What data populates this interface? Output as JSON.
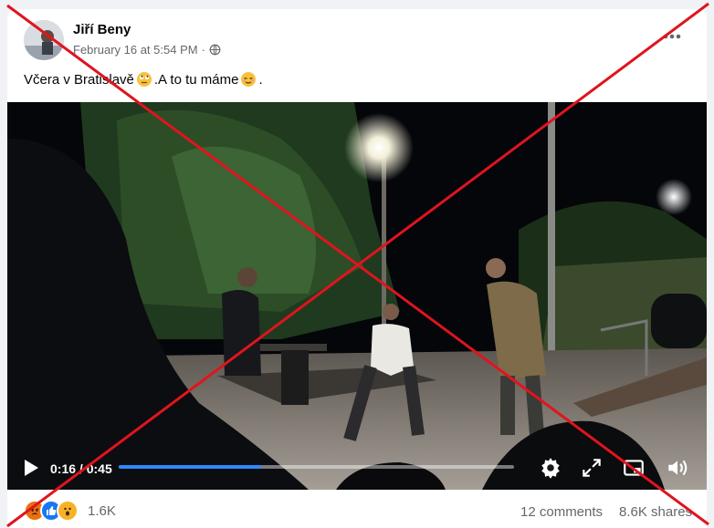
{
  "post": {
    "author": "Jiří Beny",
    "date": "February 16 at 5:54 PM",
    "separator": "·",
    "text_part1": "Včera v Bratislavě",
    "text_part2": ".A to tu máme",
    "text_part3": "."
  },
  "video": {
    "time_elapsed": "0:16",
    "time_separator": " / ",
    "time_total": "0:45",
    "progress_fraction": 0.36
  },
  "footer": {
    "reaction_count": "1.6K",
    "comments": "12 comments",
    "shares": "8.6K shares"
  },
  "colors": {
    "progress": "#2d88ff",
    "cross": "#e0141e",
    "text_secondary": "#65676b"
  },
  "icons": [
    "globe-icon",
    "more-options-icon",
    "rolling-eyes-emoji-icon",
    "relieved-emoji-icon",
    "play-icon",
    "settings-icon",
    "fullscreen-icon",
    "picture-in-picture-icon",
    "volume-icon",
    "angry-reaction-icon",
    "like-reaction-icon",
    "wow-reaction-icon"
  ]
}
